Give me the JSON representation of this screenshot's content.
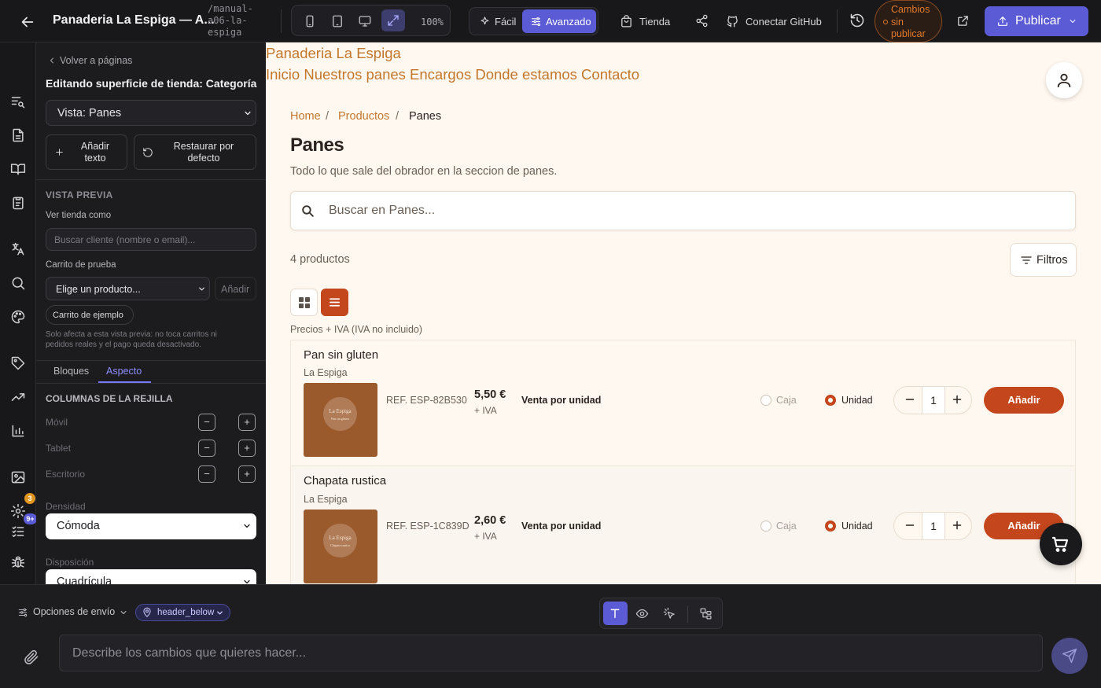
{
  "header": {
    "back_icon": "arrow-left-icon",
    "title": "Panaderia La Espiga — A...",
    "path": "/manual-\na06-la-\nespiga",
    "zoom": "100%",
    "mode_easy": "Fácil",
    "mode_advanced": "Avanzado",
    "store": "Tienda",
    "github": "Conectar GitHub",
    "unsaved": "Cambios\nsin\npublicar",
    "publish": "Publicar"
  },
  "rail": {
    "badge_a": "3",
    "badge_b": "9+"
  },
  "panel": {
    "back": "Volver a páginas",
    "title": "Editando superficie de tienda: Categoría",
    "view_select": "Vista: Panes",
    "add_text": "Añadir\ntexto",
    "reset": "Restaurar por\ndefecto",
    "preview_heading": "VISTA PREVIA",
    "view_as": "Ver tienda como",
    "customer_placeholder": "Buscar cliente (nombre o email)...",
    "test_cart": "Carrito de prueba",
    "product_select": "Elige un producto...",
    "add": "Añadir",
    "sample_cart": "Carrito de ejemplo",
    "note": "Solo afecta a esta vista previa: no toca carritos ni pedidos reales y el pago queda desactivado.",
    "tab_blocks": "Bloques",
    "tab_look": "Aspecto",
    "grid_heading": "COLUMNAS DE LA REJILLA",
    "mobile": "Móvil",
    "tablet": "Tablet",
    "desktop": "Escritorio",
    "density": "Densidad",
    "density_value": "Cómoda",
    "layout": "Disposición",
    "layout_value": "Cuadrícula"
  },
  "preview": {
    "shop_name": "Panaderia La Espiga",
    "nav": "Inicio Nuestros panes Encargos Donde estamos Contacto",
    "crumb_home": "Home",
    "crumb_products": "Productos",
    "crumb_current": "Panes",
    "page_title": "Panes",
    "subtitle": "Todo lo que sale del obrador en la seccion de panes.",
    "search_placeholder": "Buscar en Panes...",
    "count": "4 productos",
    "filters": "Filtros",
    "price_note": "Precios + IVA (IVA no incluido)",
    "products": [
      {
        "name": "Pan sin gluten",
        "brand": "La Espiga",
        "img_title": "La Espiga",
        "img_sub": "Pan sin gluten",
        "ref": "REF. ESP-82B530",
        "price": "5,50 €",
        "tax": "+ IVA",
        "sale": "Venta por unidad",
        "opt_box": "Caja",
        "opt_unit": "Unidad",
        "qty": "1",
        "add": "Añadir"
      },
      {
        "name": "Chapata rustica",
        "brand": "La Espiga",
        "img_title": "La Espiga",
        "img_sub": "Chapata rustica",
        "ref": "REF. ESP-1C839D",
        "price": "2,60 €",
        "tax": "+ IVA",
        "sale": "Venta por unidad",
        "opt_box": "Caja",
        "opt_unit": "Unidad",
        "qty": "1",
        "add": "Añadir"
      }
    ]
  },
  "bottom": {
    "shipping_options": "Opciones de envío",
    "tag": "header_below",
    "prompt_placeholder": "Describe los cambios que quieres hacer..."
  },
  "colors": {
    "accent": "#5b5bd6",
    "brand": "#c2772b",
    "add_button": "#c4461c",
    "unsaved": "#e07a2a"
  }
}
